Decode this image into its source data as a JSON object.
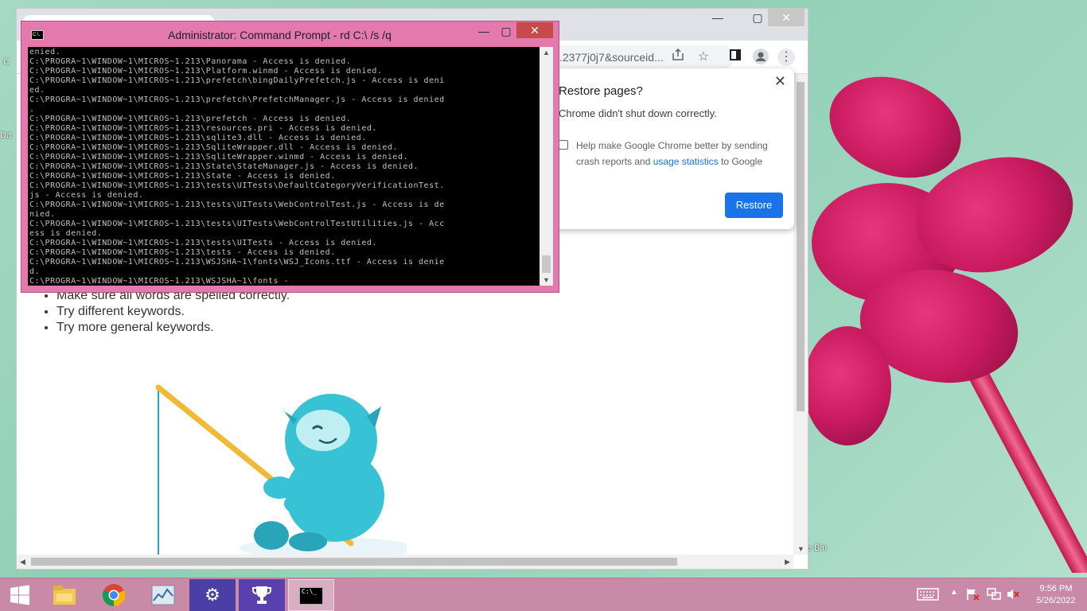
{
  "desktop": {
    "recycle_bin_label": "e Bin",
    "left_labels": [
      "C",
      "Da"
    ]
  },
  "chrome": {
    "minimize": "—",
    "maximize": "▢",
    "close": "✕",
    "omnibox_text": ".2377j0j7&sourceid...",
    "toolbar_icons": [
      "share-icon",
      "star-icon",
      "side-panel-icon",
      "profile-icon",
      "menu-icon"
    ],
    "tips": [
      "Make sure all words are spelled correctly.",
      "Try different keywords.",
      "Try more general keywords."
    ]
  },
  "restore_dialog": {
    "title": "Restore pages?",
    "message": "Chrome didn't shut down correctly.",
    "help_text_before": "Help make Google Chrome better by sending crash reports and ",
    "help_link": "usage statistics",
    "help_text_after": " to Google",
    "restore_button": "Restore",
    "close": "✕",
    "accent": "#1a73e8"
  },
  "cmd": {
    "title": "Administrator: Command Prompt - rd  C:\\ /s /q",
    "icon_text": "C:\\.",
    "minimize": "—",
    "maximize": "▢",
    "close": "✕",
    "lines": [
      "enied.",
      "C:\\PROGRA~1\\WINDOW~1\\MICROS~1.213\\Panorama - Access is denied.",
      "C:\\PROGRA~1\\WINDOW~1\\MICROS~1.213\\Platform.winmd - Access is denied.",
      "C:\\PROGRA~1\\WINDOW~1\\MICROS~1.213\\prefetch\\bingDailyPrefetch.js - Access is deni",
      "ed.",
      "C:\\PROGRA~1\\WINDOW~1\\MICROS~1.213\\prefetch\\PrefetchManager.js - Access is denied",
      ".",
      "C:\\PROGRA~1\\WINDOW~1\\MICROS~1.213\\prefetch - Access is denied.",
      "C:\\PROGRA~1\\WINDOW~1\\MICROS~1.213\\resources.pri - Access is denied.",
      "C:\\PROGRA~1\\WINDOW~1\\MICROS~1.213\\sqlite3.dll - Access is denied.",
      "C:\\PROGRA~1\\WINDOW~1\\MICROS~1.213\\SqliteWrapper.dll - Access is denied.",
      "C:\\PROGRA~1\\WINDOW~1\\MICROS~1.213\\SqliteWrapper.winmd - Access is denied.",
      "C:\\PROGRA~1\\WINDOW~1\\MICROS~1.213\\State\\StateManager.js - Access is denied.",
      "C:\\PROGRA~1\\WINDOW~1\\MICROS~1.213\\State - Access is denied.",
      "C:\\PROGRA~1\\WINDOW~1\\MICROS~1.213\\tests\\UITests\\DefaultCategoryVerificationTest.",
      "js - Access is denied.",
      "C:\\PROGRA~1\\WINDOW~1\\MICROS~1.213\\tests\\UITests\\WebControlTest.js - Access is de",
      "nied.",
      "C:\\PROGRA~1\\WINDOW~1\\MICROS~1.213\\tests\\UITests\\WebControlTestUtilities.js - Acc",
      "ess is denied.",
      "C:\\PROGRA~1\\WINDOW~1\\MICROS~1.213\\tests\\UITests - Access is denied.",
      "C:\\PROGRA~1\\WINDOW~1\\MICROS~1.213\\tests - Access is denied.",
      "C:\\PROGRA~1\\WINDOW~1\\MICROS~1.213\\WSJSHA~1\\fonts\\WSJ_Icons.ttf - Access is denie",
      "d.",
      "C:\\PROGRA~1\\WINDOW~1\\MICROS~1.213\\WSJSHA~1\\fonts -"
    ]
  },
  "taskbar": {
    "apps": [
      "file-explorer-icon",
      "chrome-icon",
      "task-manager-icon",
      "settings-icon",
      "trophy-icon",
      "cmd-icon"
    ],
    "active_app": "cmd-icon",
    "cmd_icon_text": "C:\\_",
    "time": "9:56 PM",
    "date": "5/26/2022",
    "tray_icons": [
      "keyboard-icon",
      "chevron-up-icon",
      "flag-icon",
      "network-icon",
      "volume-muted-icon"
    ]
  }
}
